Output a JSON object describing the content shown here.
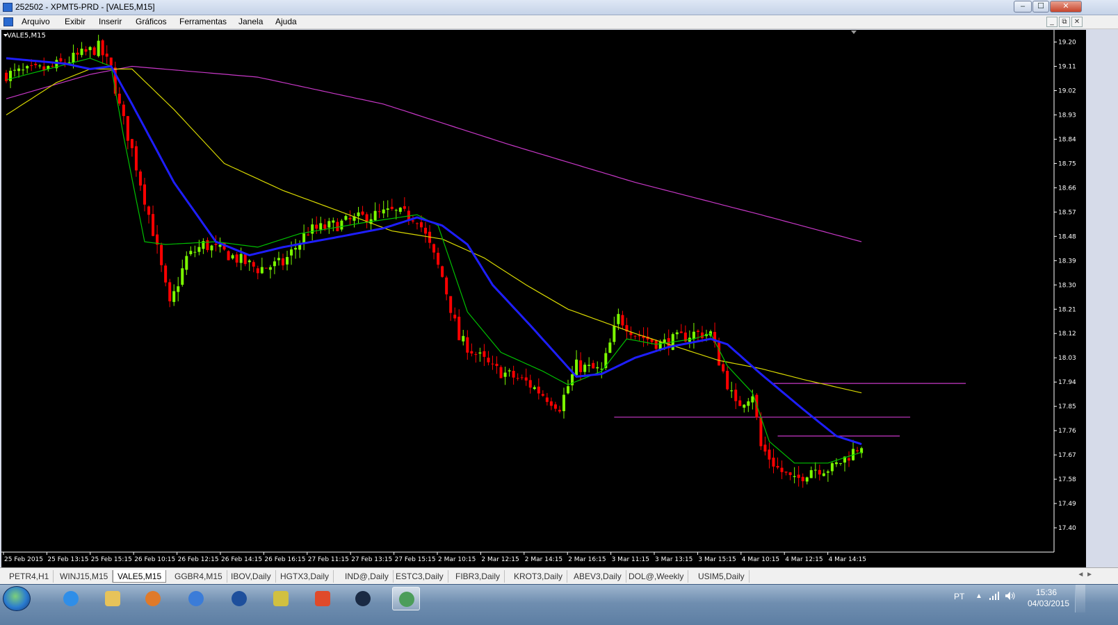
{
  "window": {
    "title": "252502 - XPMT5-PRD - [VALE5,M15]",
    "buttons": {
      "minimize": "‒",
      "maximize": "☐",
      "close": "✕"
    }
  },
  "menu": {
    "items": [
      "Arquivo",
      "Exibir",
      "Inserir",
      "Gráficos",
      "Ferramentas",
      "Janela",
      "Ajuda"
    ],
    "mdi_buttons": [
      "_",
      "⧉",
      "✕"
    ]
  },
  "chart": {
    "symbol_label": "VALE5,M15",
    "background": "#000000",
    "bull_color": "#7CFC00",
    "bear_color": "#FF0000",
    "ma_colors": {
      "fast": "#00C000",
      "mid": "#1E1EFF",
      "slow": "#D8D800",
      "long": "#C838C8"
    },
    "level_line_color": "#C838C8"
  },
  "chart_data": {
    "type": "candlestick",
    "symbol": "VALE5",
    "timeframe": "M15",
    "ylim": [
      17.31,
      19.24
    ],
    "y_ticks": [
      "19.20",
      "19.11",
      "19.02",
      "18.93",
      "18.84",
      "18.75",
      "18.66",
      "18.57",
      "18.48",
      "18.39",
      "18.30",
      "18.21",
      "18.12",
      "18.03",
      "17.94",
      "17.85",
      "17.76",
      "17.67",
      "17.58",
      "17.49",
      "17.40"
    ],
    "x_ticks": [
      "25 Feb 2015",
      "25 Feb 13:15",
      "25 Feb 15:15",
      "26 Feb 10:15",
      "26 Feb 12:15",
      "26 Feb 14:15",
      "26 Feb 16:15",
      "27 Feb 11:15",
      "27 Feb 13:15",
      "27 Feb 15:15",
      "2 Mar 10:15",
      "2 Mar 12:15",
      "2 Mar 14:15",
      "2 Mar 16:15",
      "3 Mar 11:15",
      "3 Mar 13:15",
      "3 Mar 15:15",
      "4 Mar 10:15",
      "4 Mar 12:15",
      "4 Mar 14:15"
    ],
    "series": [
      {
        "name": "",
        "kind": "candles",
        "anchors": [
          [
            0,
            19.08
          ],
          [
            10,
            19.1
          ],
          [
            22,
            19.18
          ],
          [
            25,
            19.1
          ],
          [
            27,
            18.96
          ],
          [
            30,
            18.8
          ],
          [
            35,
            18.5
          ],
          [
            39,
            18.22
          ],
          [
            43,
            18.4
          ],
          [
            47,
            18.45
          ],
          [
            52,
            18.42
          ],
          [
            60,
            18.36
          ],
          [
            66,
            18.38
          ],
          [
            72,
            18.5
          ],
          [
            78,
            18.52
          ],
          [
            85,
            18.55
          ],
          [
            92,
            18.57
          ],
          [
            98,
            18.55
          ],
          [
            100,
            18.48
          ],
          [
            104,
            18.33
          ],
          [
            108,
            18.1
          ],
          [
            116,
            17.99
          ],
          [
            124,
            17.94
          ],
          [
            132,
            17.85
          ],
          [
            136,
            18.0
          ],
          [
            142,
            17.98
          ],
          [
            146,
            18.18
          ],
          [
            150,
            18.12
          ],
          [
            156,
            18.08
          ],
          [
            164,
            18.12
          ],
          [
            168,
            18.12
          ],
          [
            170,
            18.02
          ],
          [
            174,
            17.85
          ],
          [
            178,
            17.9
          ],
          [
            180,
            17.7
          ],
          [
            184,
            17.62
          ],
          [
            188,
            17.57
          ],
          [
            192,
            17.62
          ],
          [
            197,
            17.62
          ],
          [
            201,
            17.67
          ],
          [
            204,
            17.71
          ]
        ]
      },
      {
        "name": "",
        "kind": "ma-fast",
        "anchors": [
          [
            0,
            19.06
          ],
          [
            20,
            19.14
          ],
          [
            25,
            19.11
          ],
          [
            28,
            18.85
          ],
          [
            33,
            18.46
          ],
          [
            38,
            18.45
          ],
          [
            50,
            18.46
          ],
          [
            60,
            18.44
          ],
          [
            70,
            18.49
          ],
          [
            85,
            18.53
          ],
          [
            98,
            18.56
          ],
          [
            103,
            18.52
          ],
          [
            110,
            18.2
          ],
          [
            118,
            18.05
          ],
          [
            128,
            17.98
          ],
          [
            134,
            17.93
          ],
          [
            142,
            17.98
          ],
          [
            148,
            18.1
          ],
          [
            155,
            18.08
          ],
          [
            164,
            18.1
          ],
          [
            168,
            18.12
          ],
          [
            172,
            18.0
          ],
          [
            178,
            17.9
          ],
          [
            182,
            17.72
          ],
          [
            188,
            17.64
          ],
          [
            196,
            17.64
          ],
          [
            204,
            17.68
          ]
        ]
      },
      {
        "name": "",
        "kind": "ma-mid",
        "anchors": [
          [
            0,
            19.14
          ],
          [
            14,
            19.12
          ],
          [
            20,
            19.1
          ],
          [
            25,
            19.11
          ],
          [
            30,
            18.97
          ],
          [
            40,
            18.68
          ],
          [
            50,
            18.46
          ],
          [
            58,
            18.41
          ],
          [
            66,
            18.44
          ],
          [
            80,
            18.48
          ],
          [
            90,
            18.51
          ],
          [
            98,
            18.55
          ],
          [
            104,
            18.52
          ],
          [
            110,
            18.45
          ],
          [
            116,
            18.3
          ],
          [
            125,
            18.15
          ],
          [
            136,
            17.96
          ],
          [
            142,
            17.97
          ],
          [
            150,
            18.03
          ],
          [
            158,
            18.07
          ],
          [
            168,
            18.1
          ],
          [
            172,
            18.08
          ],
          [
            180,
            17.97
          ],
          [
            190,
            17.84
          ],
          [
            198,
            17.74
          ],
          [
            204,
            17.71
          ]
        ]
      },
      {
        "name": "",
        "kind": "ma-slow",
        "anchors": [
          [
            0,
            18.93
          ],
          [
            12,
            19.05
          ],
          [
            20,
            19.1
          ],
          [
            30,
            19.1
          ],
          [
            40,
            18.95
          ],
          [
            52,
            18.75
          ],
          [
            66,
            18.65
          ],
          [
            80,
            18.57
          ],
          [
            92,
            18.5
          ],
          [
            104,
            18.47
          ],
          [
            114,
            18.4
          ],
          [
            124,
            18.3
          ],
          [
            134,
            18.21
          ],
          [
            150,
            18.12
          ],
          [
            170,
            18.02
          ],
          [
            180,
            17.99
          ],
          [
            190,
            17.95
          ],
          [
            204,
            17.9
          ]
        ]
      },
      {
        "name": "",
        "kind": "ma-long",
        "anchors": [
          [
            0,
            18.99
          ],
          [
            20,
            19.08
          ],
          [
            30,
            19.11
          ],
          [
            60,
            19.07
          ],
          [
            90,
            18.97
          ],
          [
            120,
            18.82
          ],
          [
            150,
            18.68
          ],
          [
            180,
            18.56
          ],
          [
            204,
            18.46
          ]
        ]
      }
    ],
    "horizontal_levels": [
      {
        "price": 17.935,
        "from_index": 183,
        "to_extend": "right"
      },
      {
        "price": 17.81,
        "from_index": 145,
        "to_extend": "right"
      },
      {
        "price": 17.74,
        "from_index": 184,
        "to_extend": "right"
      }
    ],
    "n_bars": 205,
    "grid": false
  },
  "tabs": {
    "items": [
      "PETR4,H1",
      "WINJ15,M15",
      "VALE5,M15",
      "GGBR4,M15",
      "IBOV,Daily",
      "HGTX3,Daily",
      "IND@,Daily",
      "ESTC3,Daily",
      "FIBR3,Daily",
      "KROT3,Daily",
      "ABEV3,Daily",
      "DOL@,Weekly",
      "USIM5,Daily"
    ],
    "active": "VALE5,M15",
    "scroll": "◄ ►"
  },
  "taskbar": {
    "icons": [
      "windows-start",
      "internet-explorer",
      "file-explorer",
      "media-player",
      "remote-desktop",
      "hp-icon",
      "winrar",
      "chrome",
      "xp-investimentos",
      "metatrader"
    ],
    "tray": {
      "language": "PT",
      "time": "15:36",
      "date": "04/03/2015"
    }
  }
}
